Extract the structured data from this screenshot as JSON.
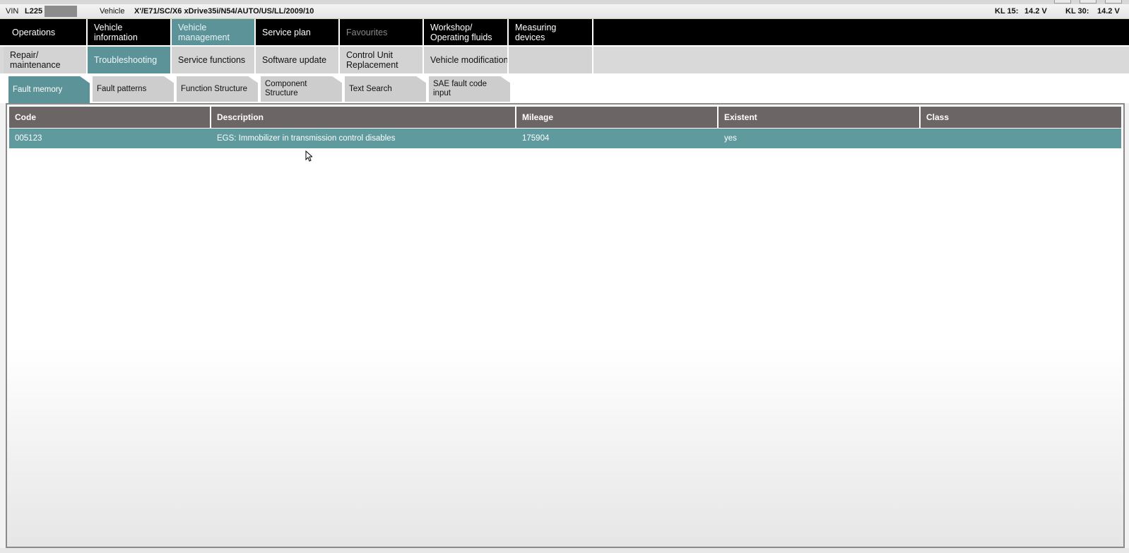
{
  "infobar": {
    "vin_label": "VIN",
    "vin_value": "L225",
    "vehicle_label": "Vehicle",
    "vehicle_value": "X'/E71/SC/X6 xDrive35i/N54/AUTO/US/LL/2009/10",
    "kl15_label": "KL 15:",
    "kl15_value": "14.2 V",
    "kl30_label": "KL 30:",
    "kl30_value": "14.2 V"
  },
  "main_nav": {
    "operations": "Operations",
    "vehicle_information": "Vehicle information",
    "vehicle_management": "Vehicle management",
    "service_plan": "Service plan",
    "favourites": "Favourites",
    "workshop": "Workshop/ Operating fluids",
    "measuring_devices": "Measuring devices"
  },
  "sub_nav": {
    "repair": "Repair/ maintenance",
    "troubleshooting": "Troubleshooting",
    "service_functions": "Service functions",
    "software_update": "Software update",
    "control_unit_replacement": "Control Unit Replacement",
    "vehicle_modification": "Vehicle modification"
  },
  "tabs": {
    "fault_memory": "Fault memory",
    "fault_patterns": "Fault patterns",
    "function_structure": "Function Structure",
    "component_structure": "Component Structure",
    "text_search": "Text Search",
    "sae_fault_code_input": "SAE fault code input"
  },
  "table": {
    "headers": [
      "Code",
      "Description",
      "Mileage",
      "Existent",
      "Class"
    ],
    "rows": [
      [
        "005123",
        "EGS: Immobilizer in transmission control disables",
        "175904",
        "yes",
        ""
      ]
    ]
  },
  "colors": {
    "accent": "#5b9398",
    "header_bg": "#6b6565",
    "selected_row": "#5f9a9e"
  }
}
